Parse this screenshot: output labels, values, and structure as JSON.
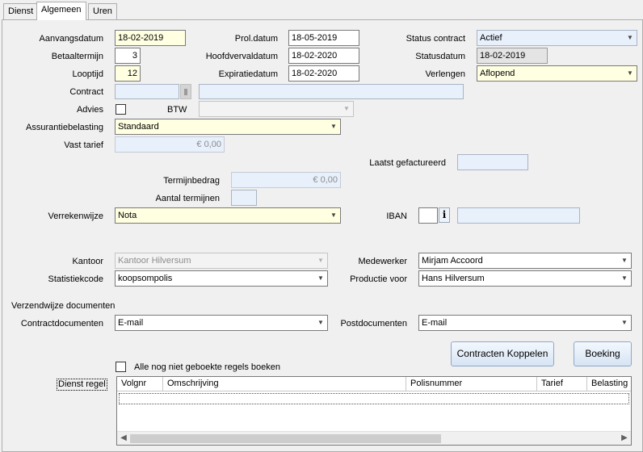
{
  "tabs": [
    "Dienst",
    "Algemeen",
    "Uren"
  ],
  "labels": {
    "aanvangsdatum": "Aanvangsdatum",
    "betaaltermijn": "Betaaltermijn",
    "looptijd": "Looptijd",
    "contract": "Contract",
    "advies": "Advies",
    "btw": "BTW",
    "assurantiebelasting": "Assurantiebelasting",
    "vast_tarief": "Vast tarief",
    "prol_datum": "Prol.datum",
    "hoofdvervaldatum": "Hoofdvervaldatum",
    "expiratiedatum": "Expiratiedatum",
    "status_contract": "Status contract",
    "statusdatum": "Statusdatum",
    "verlengen": "Verlengen",
    "laatst_gefactureerd": "Laatst gefactureerd",
    "termijnbedrag": "Termijnbedrag",
    "aantal_termijnen": "Aantal termijnen",
    "verrekenwijze": "Verrekenwijze",
    "iban": "IBAN",
    "kantoor": "Kantoor",
    "statistiekcode": "Statistiekcode",
    "medewerker": "Medewerker",
    "productie_voor": "Productie voor",
    "verzendwijze_documenten": "Verzendwijze documenten",
    "contractdocumenten": "Contractdocumenten",
    "postdocumenten": "Postdocumenten",
    "alle_boeken": "Alle nog niet geboekte regels boeken",
    "dienst_regel": "Dienst regel"
  },
  "values": {
    "aanvangsdatum": "18-02-2019",
    "betaaltermijn": "3",
    "looptijd": "12",
    "contract": "",
    "contract_description": "",
    "advies_checked": false,
    "btw": "",
    "assurantiebelasting": "Standaard",
    "vast_tarief": "€ 0,00",
    "prol_datum": "18-05-2019",
    "hoofdvervaldatum": "18-02-2020",
    "expiratiedatum": "18-02-2020",
    "status_contract": "Actief",
    "statusdatum": "18-02-2019",
    "verlengen": "Aflopend",
    "laatst_gefactureerd": "",
    "termijnbedrag": "€ 0,00",
    "aantal_termijnen": "",
    "verrekenwijze": "Nota",
    "iban_prefix": "",
    "iban": "",
    "kantoor": "Kantoor Hilversum",
    "statistiekcode": "koopsompolis",
    "medewerker": "Mirjam Accoord",
    "productie_voor": "Hans Hilversum",
    "contractdocumenten": "E-mail",
    "postdocumenten": "E-mail",
    "alle_boeken_checked": false
  },
  "buttons": {
    "contracten_koppelen": "Contracten Koppelen",
    "boeking": "Boeking",
    "info": "i"
  },
  "grid": {
    "columns": [
      "Volgnr",
      "Omschrijving",
      "Polisnummer",
      "Tarief",
      "Belasting"
    ],
    "rows": []
  },
  "colors": {
    "required_field": "#ffffe1",
    "readonly_field": "#e7f0fb",
    "button_border": "#8fa8c8"
  }
}
